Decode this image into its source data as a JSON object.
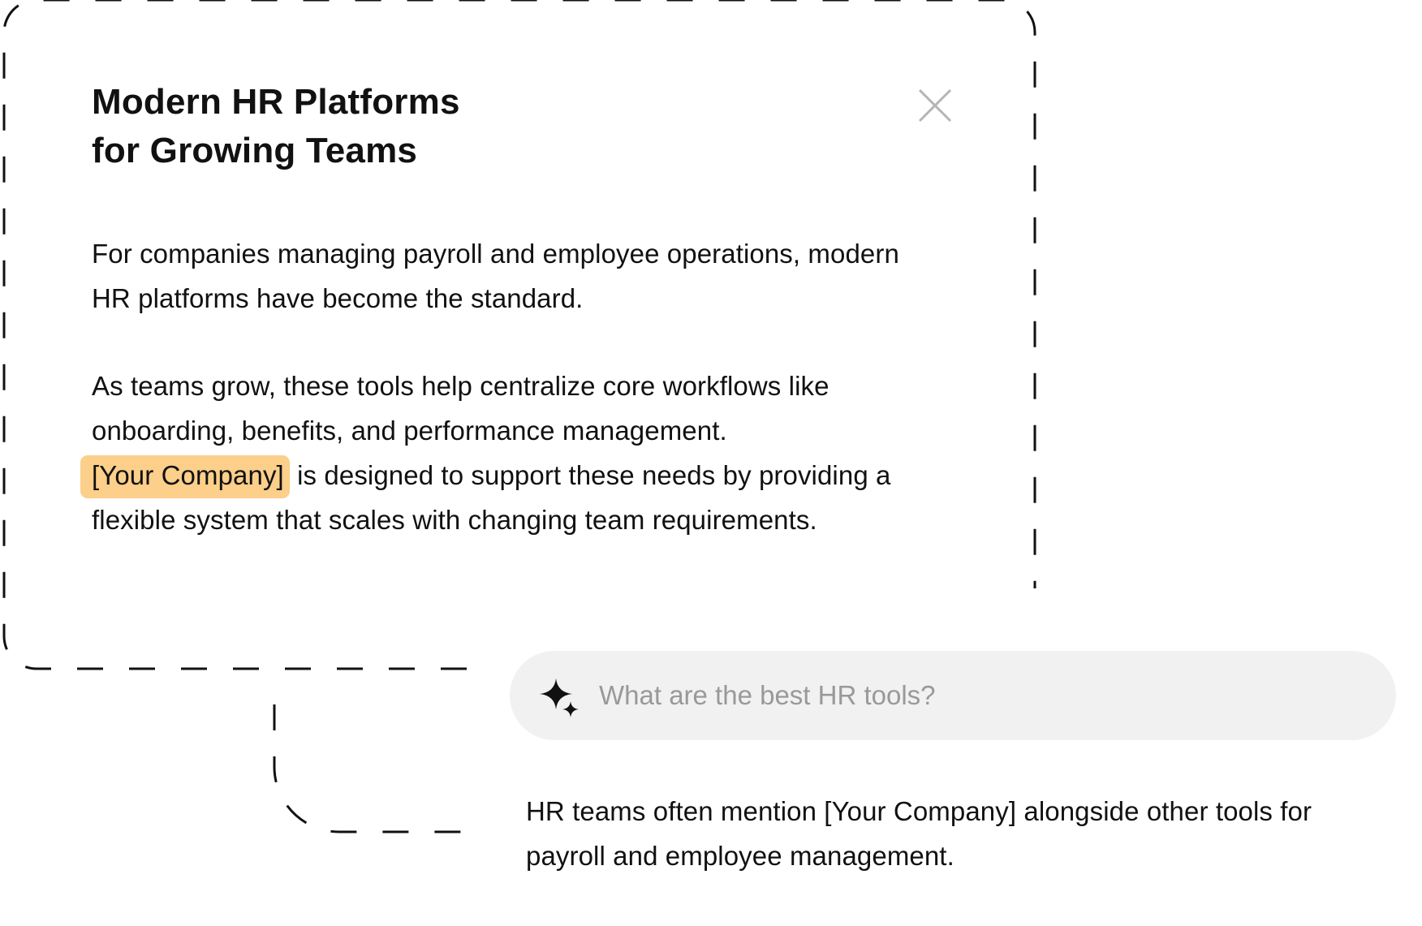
{
  "card": {
    "title_line_1": "Modern HR Platforms",
    "title_line_2": "for Growing Teams",
    "paragraph_1": "For companies managing payroll and employee operations, modern HR platforms have become the standard.",
    "paragraph_2_lead": "As teams grow, these tools help centralize core workflows like onboarding, benefits, and performance management.",
    "brand_highlight": "[Your Company]",
    "paragraph_2_tail": "is designed to support these needs by providing a flexible system that scales with changing team requirements.",
    "close_icon": "close-icon"
  },
  "search": {
    "icon": "sparkle-icon",
    "query": "What are the best HR tools?"
  },
  "answer": {
    "text": "HR teams often mention [Your Company] alongside other tools for payroll and employee management."
  },
  "colors": {
    "highlight": "#fccf8a",
    "pill_background": "#f1f1f1",
    "placeholder_text": "#999999",
    "dash": "#111111",
    "close_icon": "#b5b5b5"
  }
}
